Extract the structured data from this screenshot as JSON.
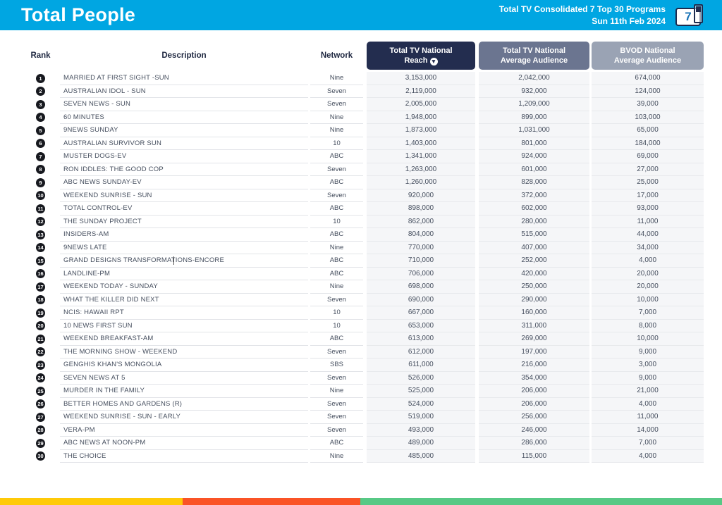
{
  "header": {
    "title": "Total People",
    "subtitle_line1": "Total TV Consolidated 7 Top 30 Programs",
    "subtitle_line2": "Sun 11th Feb 2024",
    "channel_badge_number": "7"
  },
  "colors": {
    "header_bg": "#00a6e2",
    "reach_header_bg": "#232d4f",
    "avg_header_bg": "#6b7590",
    "bvod_header_bg": "#9aa3b4",
    "footer_bar_segments": [
      "#ffca08",
      "#fa5326",
      "#57c985"
    ]
  },
  "table": {
    "columns": {
      "rank": "Rank",
      "description": "Description",
      "network": "Network",
      "reach_line1": "Total TV National",
      "reach_line2": "Reach",
      "reach_sort": "descending",
      "avg_line1": "Total TV National",
      "avg_line2": "Average Audience",
      "bvod_line1": "BVOD National",
      "bvod_line2": "Average Audience"
    },
    "rows": [
      {
        "rank": 1,
        "description": "MARRIED AT FIRST SIGHT -SUN",
        "network": "Nine",
        "reach": "3,153,000",
        "avg_audience": "2,042,000",
        "bvod_audience": "674,000"
      },
      {
        "rank": 2,
        "description": "AUSTRALIAN IDOL - SUN",
        "network": "Seven",
        "reach": "2,119,000",
        "avg_audience": "932,000",
        "bvod_audience": "124,000"
      },
      {
        "rank": 3,
        "description": "SEVEN NEWS - SUN",
        "network": "Seven",
        "reach": "2,005,000",
        "avg_audience": "1,209,000",
        "bvod_audience": "39,000"
      },
      {
        "rank": 4,
        "description": "60 MINUTES",
        "network": "Nine",
        "reach": "1,948,000",
        "avg_audience": "899,000",
        "bvod_audience": "103,000"
      },
      {
        "rank": 5,
        "description": "9NEWS SUNDAY",
        "network": "Nine",
        "reach": "1,873,000",
        "avg_audience": "1,031,000",
        "bvod_audience": "65,000"
      },
      {
        "rank": 6,
        "description": "AUSTRALIAN SURVIVOR SUN",
        "network": "10",
        "reach": "1,403,000",
        "avg_audience": "801,000",
        "bvod_audience": "184,000"
      },
      {
        "rank": 7,
        "description": "MUSTER DOGS-EV",
        "network": "ABC",
        "reach": "1,341,000",
        "avg_audience": "924,000",
        "bvod_audience": "69,000"
      },
      {
        "rank": 8,
        "description": "RON IDDLES: THE GOOD COP",
        "network": "Seven",
        "reach": "1,263,000",
        "avg_audience": "601,000",
        "bvod_audience": "27,000"
      },
      {
        "rank": 9,
        "description": "ABC NEWS SUNDAY-EV",
        "network": "ABC",
        "reach": "1,260,000",
        "avg_audience": "828,000",
        "bvod_audience": "25,000"
      },
      {
        "rank": 10,
        "description": "WEEKEND SUNRISE - SUN",
        "network": "Seven",
        "reach": "920,000",
        "avg_audience": "372,000",
        "bvod_audience": "17,000"
      },
      {
        "rank": 11,
        "description": "TOTAL CONTROL-EV",
        "network": "ABC",
        "reach": "898,000",
        "avg_audience": "602,000",
        "bvod_audience": "93,000"
      },
      {
        "rank": 12,
        "description": "THE SUNDAY PROJECT",
        "network": "10",
        "reach": "862,000",
        "avg_audience": "280,000",
        "bvod_audience": "11,000"
      },
      {
        "rank": 13,
        "description": "INSIDERS-AM",
        "network": "ABC",
        "reach": "804,000",
        "avg_audience": "515,000",
        "bvod_audience": "44,000"
      },
      {
        "rank": 14,
        "description": "9NEWS LATE",
        "network": "Nine",
        "reach": "770,000",
        "avg_audience": "407,000",
        "bvod_audience": "34,000"
      },
      {
        "rank": 15,
        "description": "GRAND DESIGNS TRANSFORMATIONS-ENCORE",
        "network": "ABC",
        "reach": "710,000",
        "avg_audience": "252,000",
        "bvod_audience": "4,000",
        "text_cursor": true
      },
      {
        "rank": 16,
        "description": "LANDLINE-PM",
        "network": "ABC",
        "reach": "706,000",
        "avg_audience": "420,000",
        "bvod_audience": "20,000"
      },
      {
        "rank": 17,
        "description": "WEEKEND TODAY - SUNDAY",
        "network": "Nine",
        "reach": "698,000",
        "avg_audience": "250,000",
        "bvod_audience": "20,000"
      },
      {
        "rank": 18,
        "description": "WHAT THE KILLER DID NEXT",
        "network": "Seven",
        "reach": "690,000",
        "avg_audience": "290,000",
        "bvod_audience": "10,000"
      },
      {
        "rank": 19,
        "description": "NCIS: HAWAII RPT",
        "network": "10",
        "reach": "667,000",
        "avg_audience": "160,000",
        "bvod_audience": "7,000"
      },
      {
        "rank": 20,
        "description": "10 NEWS FIRST SUN",
        "network": "10",
        "reach": "653,000",
        "avg_audience": "311,000",
        "bvod_audience": "8,000"
      },
      {
        "rank": 21,
        "description": "WEEKEND BREAKFAST-AM",
        "network": "ABC",
        "reach": "613,000",
        "avg_audience": "269,000",
        "bvod_audience": "10,000"
      },
      {
        "rank": 22,
        "description": "THE MORNING SHOW - WEEKEND",
        "network": "Seven",
        "reach": "612,000",
        "avg_audience": "197,000",
        "bvod_audience": "9,000"
      },
      {
        "rank": 23,
        "description": "GENGHIS KHAN'S MONGOLIA",
        "network": "SBS",
        "reach": "611,000",
        "avg_audience": "216,000",
        "bvod_audience": "3,000"
      },
      {
        "rank": 24,
        "description": "SEVEN NEWS AT 5",
        "network": "Seven",
        "reach": "526,000",
        "avg_audience": "354,000",
        "bvod_audience": "9,000"
      },
      {
        "rank": 25,
        "description": "MURDER IN THE FAMILY",
        "network": "Nine",
        "reach": "525,000",
        "avg_audience": "206,000",
        "bvod_audience": "21,000"
      },
      {
        "rank": 26,
        "description": "BETTER HOMES AND GARDENS (R)",
        "network": "Seven",
        "reach": "524,000",
        "avg_audience": "206,000",
        "bvod_audience": "4,000"
      },
      {
        "rank": 27,
        "description": "WEEKEND SUNRISE - SUN - EARLY",
        "network": "Seven",
        "reach": "519,000",
        "avg_audience": "256,000",
        "bvod_audience": "11,000"
      },
      {
        "rank": 28,
        "description": "VERA-PM",
        "network": "Seven",
        "reach": "493,000",
        "avg_audience": "246,000",
        "bvod_audience": "14,000"
      },
      {
        "rank": 29,
        "description": "ABC NEWS AT NOON-PM",
        "network": "ABC",
        "reach": "489,000",
        "avg_audience": "286,000",
        "bvod_audience": "7,000"
      },
      {
        "rank": 30,
        "description": "THE CHOICE",
        "network": "Nine",
        "reach": "485,000",
        "avg_audience": "115,000",
        "bvod_audience": "4,000"
      }
    ]
  }
}
